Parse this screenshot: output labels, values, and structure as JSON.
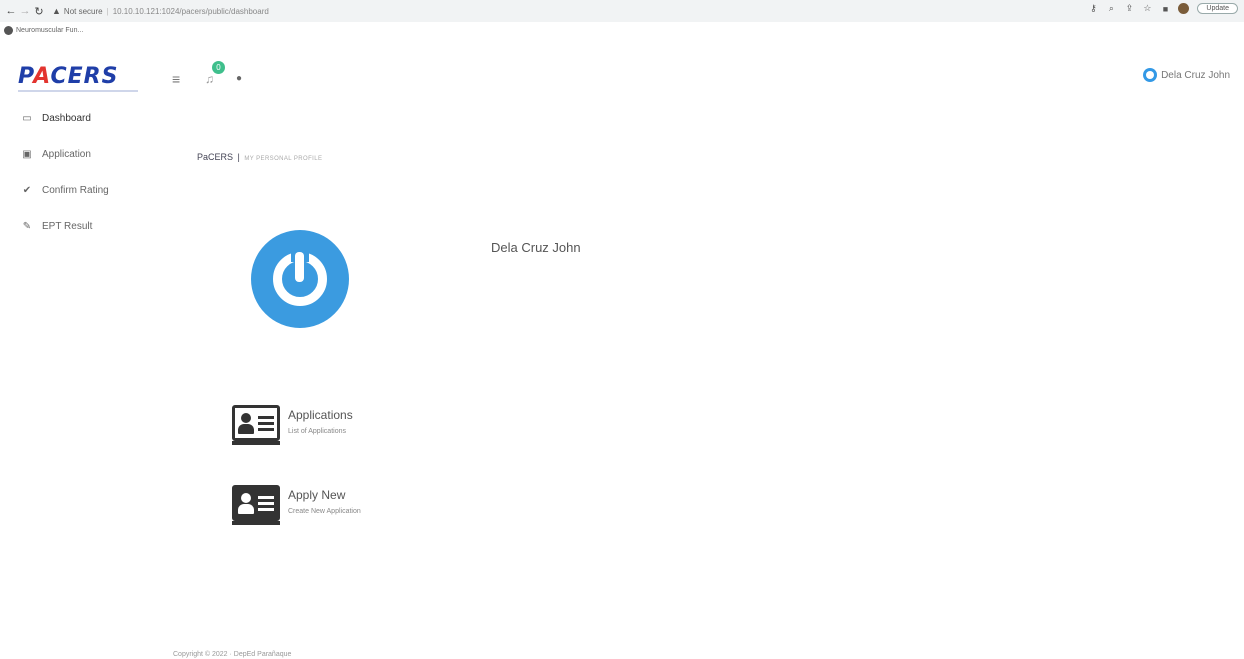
{
  "browser": {
    "not_secure": "Not secure",
    "url": "10.10.10.121:1024/pacers/public/dashboard",
    "update_label": "Update",
    "bookmark": "Neuromuscular Fun..."
  },
  "header": {
    "logo_part1": "P",
    "logo_accent": "A",
    "logo_part2": "CERS",
    "notification_count": "0",
    "user_name": "Dela Cruz John"
  },
  "sidebar": {
    "items": [
      {
        "label": "Dashboard",
        "icon": "monitor-icon"
      },
      {
        "label": "Application",
        "icon": "id-card-icon"
      },
      {
        "label": "Confirm Rating",
        "icon": "check-icon"
      },
      {
        "label": "EPT Result",
        "icon": "edit-icon"
      }
    ]
  },
  "main": {
    "breadcrumb_app": "PaCERS",
    "breadcrumb_sep": "|",
    "breadcrumb_sub": "My Personal Profile",
    "profile_name": "Dela Cruz John",
    "tiles": [
      {
        "title": "Applications",
        "subtitle": "List of Applications"
      },
      {
        "title": "Apply New",
        "subtitle": "Create New Application"
      }
    ]
  },
  "footer": {
    "text": "Copyright © 2022 · DepEd Parañaque"
  },
  "colors": {
    "brand_blue": "#1f3ea8",
    "brand_red": "#e3342f",
    "avatar_blue": "#3b9be0",
    "badge_green": "#3fbf8c"
  }
}
